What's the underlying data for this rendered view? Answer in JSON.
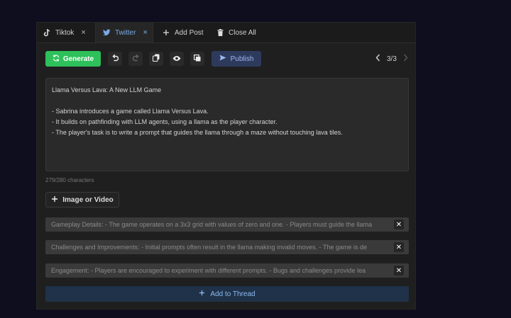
{
  "tabs": [
    {
      "label": "Tiktok",
      "icon": "tiktok-icon",
      "close": "×"
    },
    {
      "label": "Twitter",
      "icon": "twitter-icon",
      "close": "×"
    }
  ],
  "tab_actions": {
    "add_post": "Add Post",
    "close_all": "Close All"
  },
  "toolbar": {
    "generate_label": "Generate",
    "publish_label": "Publish",
    "page_indicator": "3/3",
    "colors": {
      "generate": "#2ec05a",
      "publish": "#2e3a5c",
      "active_tab": "#7aa9e6"
    }
  },
  "post": {
    "lines": [
      "Llama Versus Lava: A New LLM Game",
      "",
      "- Sabrina introduces a game called Llama Versus Lava.",
      "- It builds on pathfinding with LLM agents, using a llama as the player character.",
      "- The player's task is to write a prompt that guides the llama through a maze without touching lava tiles."
    ],
    "char_count": "279/280 characters"
  },
  "media_button": "Image or Video",
  "thread_items": [
    "Gameplay Details: - The game operates on a 3x3 grid with values of zero and one. - Players must guide the llama",
    "Challenges and Improvements: - Initial prompts often result in the llama making invalid moves. - The game is de",
    "Engagement: - Players are encouraged to experiment with different prompts. - Bugs and challenges provide lea"
  ],
  "thread_close": "✕",
  "add_thread_label": "Add to Thread"
}
